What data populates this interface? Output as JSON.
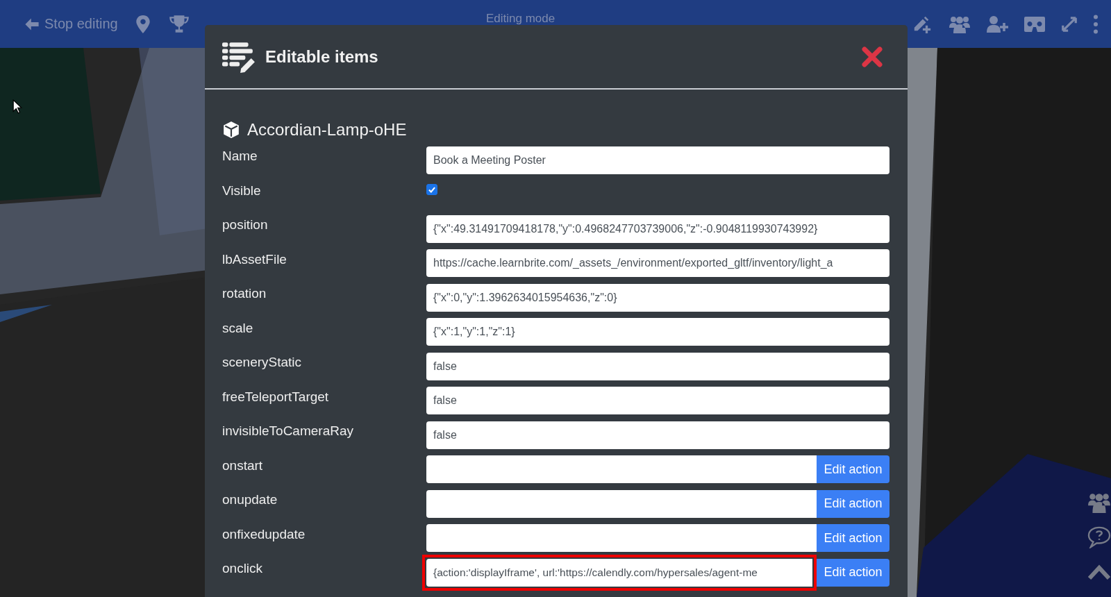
{
  "topbar": {
    "stop_editing": "Stop editing",
    "mode_title": "Editing mode"
  },
  "dialog": {
    "title": "Editable items",
    "object_name": "Accordian-Lamp-oHE",
    "fields": [
      {
        "label": "Name",
        "kind": "text",
        "value": "Book a Meeting Poster"
      },
      {
        "label": "Visible",
        "kind": "checkbox",
        "checked": true
      },
      {
        "label": "position",
        "kind": "text",
        "value": "{\"x\":49.31491709418178,\"y\":0.4968247703739006,\"z\":-0.9048119930743992}"
      },
      {
        "label": "lbAssetFile",
        "kind": "text",
        "value": "https://cache.learnbrite.com/_assets_/environment/exported_gltf/inventory/light_a"
      },
      {
        "label": "rotation",
        "kind": "text",
        "value": "{\"x\":0,\"y\":1.3962634015954636,\"z\":0}"
      },
      {
        "label": "scale",
        "kind": "text",
        "value": "{\"x\":1,\"y\":1,\"z\":1}"
      },
      {
        "label": "sceneryStatic",
        "kind": "text",
        "value": "false"
      },
      {
        "label": "freeTeleportTarget",
        "kind": "text",
        "value": "false"
      },
      {
        "label": "invisibleToCameraRay",
        "kind": "text",
        "value": "false"
      },
      {
        "label": "onstart",
        "kind": "action",
        "button": "Edit action",
        "highlighted": false
      },
      {
        "label": "onupdate",
        "kind": "action",
        "button": "Edit action",
        "highlighted": false
      },
      {
        "label": "onfixedupdate",
        "kind": "action",
        "button": "Edit action",
        "highlighted": false
      },
      {
        "label": "onclick",
        "kind": "action",
        "button": "Edit action",
        "value": "{action:'displayIframe', url:'https://calendly.com/hypersales/agent-me",
        "highlighted": true
      }
    ]
  }
}
